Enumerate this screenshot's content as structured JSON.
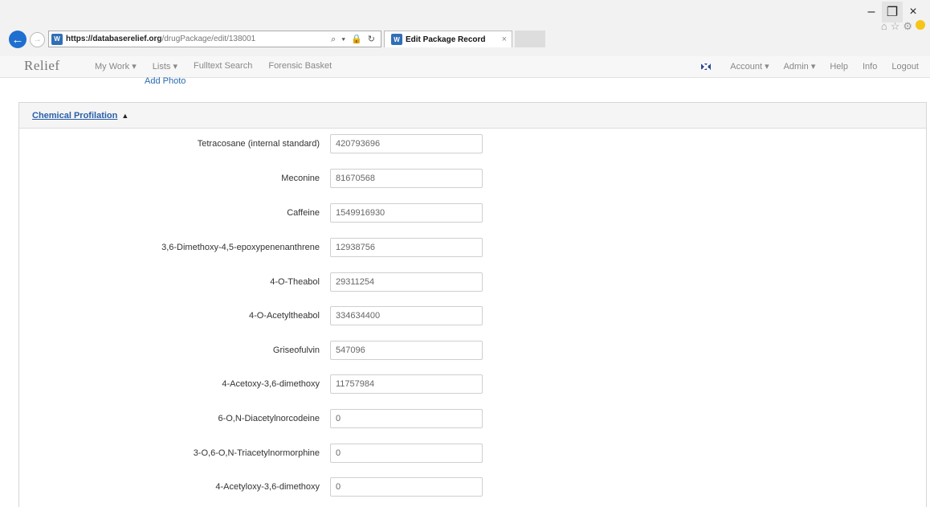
{
  "browser": {
    "url_host": "https://databaserelief.org",
    "url_path": "/drugPackage/edit/138001",
    "addr_actions": "⌕ ▾ 🔒 ↻",
    "favicon_text": "W",
    "tab_title": "Edit Package Record",
    "tab_close": "×",
    "win_minimize": "–",
    "win_maximize": "❐",
    "win_close": "×",
    "icons": [
      "home-icon",
      "star-icon",
      "gear-icon",
      "smiley-icon"
    ]
  },
  "navbar": {
    "brand": "Relief",
    "left_items": [
      "My Work ▾",
      "Lists ▾",
      "Fulltext Search",
      "Forensic Basket"
    ],
    "right_items": [
      "Account ▾",
      "Admin ▾",
      "Help",
      "Info",
      "Logout"
    ]
  },
  "add_photo": "Add Photo",
  "panel": {
    "title": "Chemical Profilation",
    "caret": "▲",
    "fields": [
      {
        "label": "Tetracosane (internal standard)",
        "value": "420793696"
      },
      {
        "label": "Meconine",
        "value": "81670568"
      },
      {
        "label": "Caffeine",
        "value": "1549916930"
      },
      {
        "label": "3,6-Dimethoxy-4,5-epoxypenenanthrene",
        "value": "12938756"
      },
      {
        "label": "4-O-Theabol",
        "value": "29311254"
      },
      {
        "label": "4-O-Acetyltheabol",
        "value": "334634400"
      },
      {
        "label": "Griseofulvin",
        "value": "547096"
      },
      {
        "label": "4-Acetoxy-3,6-dimethoxy",
        "value": "11757984"
      },
      {
        "label": "6-O,N-Diacetylnorcodeine",
        "value": "0"
      },
      {
        "label": "3-O,6-O,N-Triacetylnormorphine",
        "value": "0"
      },
      {
        "label": "4-Acetyloxy-3,6-dimethoxy",
        "value": "0"
      }
    ]
  }
}
